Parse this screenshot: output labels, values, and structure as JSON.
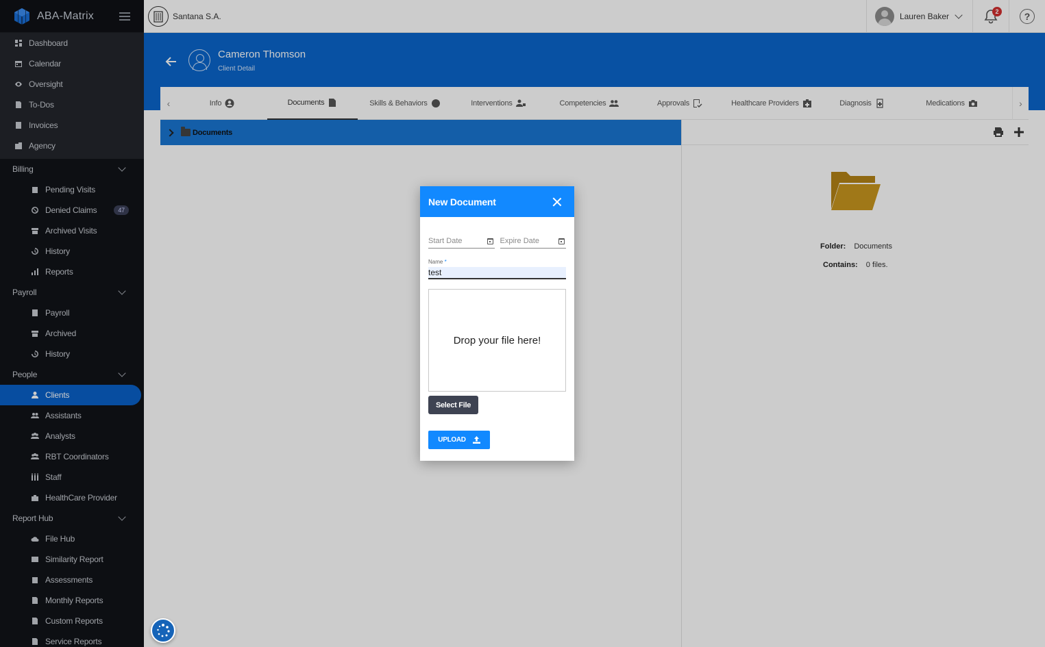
{
  "app": {
    "name": "ABA-Matrix"
  },
  "company": {
    "name": "Santana S.A."
  },
  "user": {
    "name": "Lauren Baker"
  },
  "notifications": {
    "count": "2"
  },
  "sidebar": {
    "top_items": [
      {
        "label": "Dashboard",
        "icon": "dashboard-icon"
      },
      {
        "label": "Calendar",
        "icon": "calendar-icon"
      },
      {
        "label": "Oversight",
        "icon": "eye-icon"
      },
      {
        "label": "To-Dos",
        "icon": "todo-icon"
      },
      {
        "label": "Invoices",
        "icon": "invoice-icon"
      },
      {
        "label": "Agency",
        "icon": "building-icon"
      }
    ],
    "billing": {
      "title": "Billing",
      "items": [
        {
          "label": "Pending Visits"
        },
        {
          "label": "Denied Claims",
          "badge": "47"
        },
        {
          "label": "Archived Visits"
        },
        {
          "label": "History"
        },
        {
          "label": "Reports"
        }
      ]
    },
    "payroll": {
      "title": "Payroll",
      "items": [
        {
          "label": "Payroll"
        },
        {
          "label": "Archived"
        },
        {
          "label": "History"
        }
      ]
    },
    "people": {
      "title": "People",
      "items": [
        {
          "label": "Clients"
        },
        {
          "label": "Assistants"
        },
        {
          "label": "Analysts"
        },
        {
          "label": "RBT Coordinators"
        },
        {
          "label": "Staff"
        },
        {
          "label": "HealthCare Provider"
        }
      ]
    },
    "report_hub": {
      "title": "Report Hub",
      "items": [
        {
          "label": "File Hub"
        },
        {
          "label": "Similarity Report"
        },
        {
          "label": "Assessments"
        },
        {
          "label": "Monthly Reports"
        },
        {
          "label": "Custom Reports"
        },
        {
          "label": "Service Reports"
        }
      ]
    }
  },
  "header": {
    "client_name": "Cameron Thomson",
    "subtitle": "Client Detail"
  },
  "tabs": [
    {
      "label": "Info"
    },
    {
      "label": "Documents"
    },
    {
      "label": "Skills & Behaviors"
    },
    {
      "label": "Interventions"
    },
    {
      "label": "Competencies"
    },
    {
      "label": "Approvals"
    },
    {
      "label": "Healthcare Providers"
    },
    {
      "label": "Diagnosis"
    },
    {
      "label": "Medications"
    }
  ],
  "tree": {
    "root_label": "Documents"
  },
  "details": {
    "folder_label": "Folder:",
    "folder_value": "Documents",
    "contains_label": "Contains:",
    "contains_value": "0 files."
  },
  "modal": {
    "title": "New Document",
    "start_date_placeholder": "Start Date",
    "expire_date_placeholder": "Expire Date",
    "name_label": "Name",
    "name_required": "*",
    "name_value": "test",
    "dropzone_text": "Drop your file here!",
    "select_file_label": "Select File",
    "upload_label": "UPLOAD"
  },
  "colors": {
    "primary": "#0a66cc",
    "accent": "#1289ff",
    "sidebar_bg": "#111318",
    "folder": "#c9971f"
  }
}
